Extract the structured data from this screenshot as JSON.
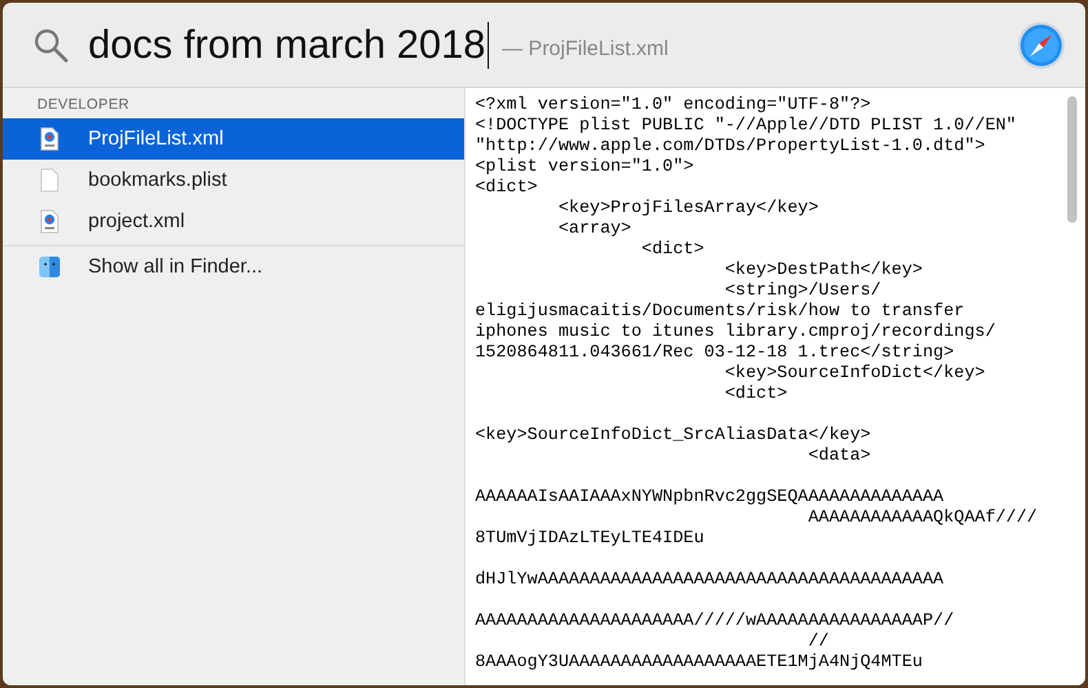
{
  "search": {
    "query": "docs from march 2018",
    "suggestion": "— ProjFileList.xml"
  },
  "sections": [
    {
      "header": "DEVELOPER",
      "items": [
        {
          "label": "ProjFileList.xml",
          "kind": "xml",
          "selected": true
        },
        {
          "label": "bookmarks.plist",
          "kind": "document",
          "selected": false
        },
        {
          "label": "project.xml",
          "kind": "xml",
          "selected": false
        }
      ]
    }
  ],
  "show_all": {
    "label": "Show all in Finder..."
  },
  "preview": {
    "blocks": [
      {
        "lines": [
          "<?xml version=\"1.0\" encoding=\"UTF-8\"?>",
          "<!DOCTYPE plist PUBLIC \"-//Apple//DTD PLIST 1.0//EN\"",
          "\"http://www.apple.com/DTDs/PropertyList-1.0.dtd\">",
          "<plist version=\"1.0\">",
          "<dict>",
          "        <key>ProjFilesArray</key>",
          "        <array>",
          "                <dict>",
          "                        <key>DestPath</key>",
          "                        <string>/Users/",
          "eligijusmacaitis/Documents/risk/how to transfer",
          "iphones music to itunes library.cmproj/recordings/",
          "1520864811.043661/Rec 03-12-18 1.trec</string>",
          "                        <key>SourceInfoDict</key>",
          "                        <dict>"
        ]
      },
      {
        "lines": [
          "<key>SourceInfoDict_SrcAliasData</key>",
          "                                <data>"
        ]
      },
      {
        "lines": [
          "AAAAAAIsAAIAAAxNYWNpbnRvc2ggSEQAAAAAAAAAAAAAA",
          "                                AAAAAAAAAAAAQkQAAf////",
          "8TUmVjIDAzLTEyLTE4IDEu"
        ]
      },
      {
        "lines": [
          "dHJlYwAAAAAAAAAAAAAAAAAAAAAAAAAAAAAAAAAAAAAAA"
        ]
      },
      {
        "lines": [
          "AAAAAAAAAAAAAAAAAAAAA/////wAAAAAAAAAAAAAAAAP//",
          "                                //",
          "8AAAogY3UAAAAAAAAAAAAAAAAAAETE1MjA4NjQ4MTEu"
        ]
      }
    ]
  }
}
